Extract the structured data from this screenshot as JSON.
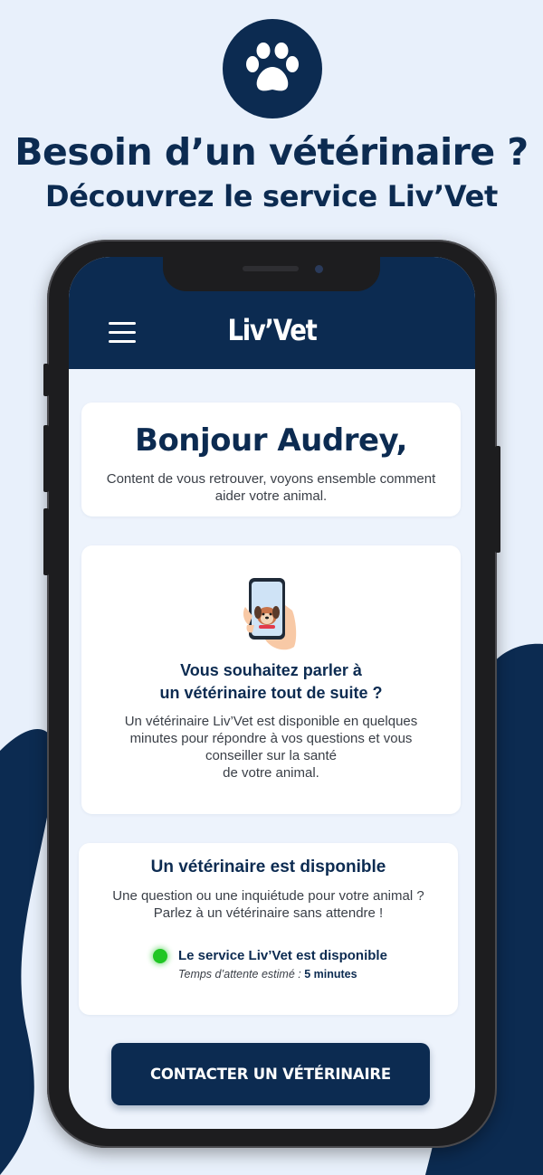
{
  "promo_banner": {
    "headline_line1": "Besoin d’un vétérinaire ?",
    "headline_line2": "Découvrez le service Liv’Vet",
    "icon": "paw-icon"
  },
  "app": {
    "brand": "Liv’Vet",
    "menu_icon": "hamburger-menu-icon"
  },
  "greeting": {
    "title": "Bonjour Audrey,",
    "text": "Content de vous retrouver, voyons ensemble comment aider votre animal."
  },
  "promo_card": {
    "illustration": "phone-with-dog-illustration",
    "title_line1": "Vous souhaitez parler à",
    "title_line2": "un vétérinaire tout de suite ?",
    "text_line1": "Un vétérinaire Liv’Vet est disponible en quelques",
    "text_line2": "minutes pour répondre à vos questions et vous",
    "text_line3": "conseiller sur la santé",
    "text_line4": "de votre animal."
  },
  "availability": {
    "title": "Un vétérinaire est disponible",
    "text_line1": "Une question ou une inquiétude pour votre animal ?",
    "text_line2": "Parlez à un vétérinaire sans attendre !",
    "status_label": "Le service Liv’Vet est disponible",
    "status_color": "#20c623",
    "wait_label": "Temps d’attente estimé :",
    "wait_value": "5 minutes"
  },
  "cta": {
    "label": "CONTACTER UN VÉTÉRINAIRE"
  },
  "colors": {
    "navy": "#0c2b51",
    "background": "#e8f0fb",
    "screen_background": "#edf3fc"
  }
}
